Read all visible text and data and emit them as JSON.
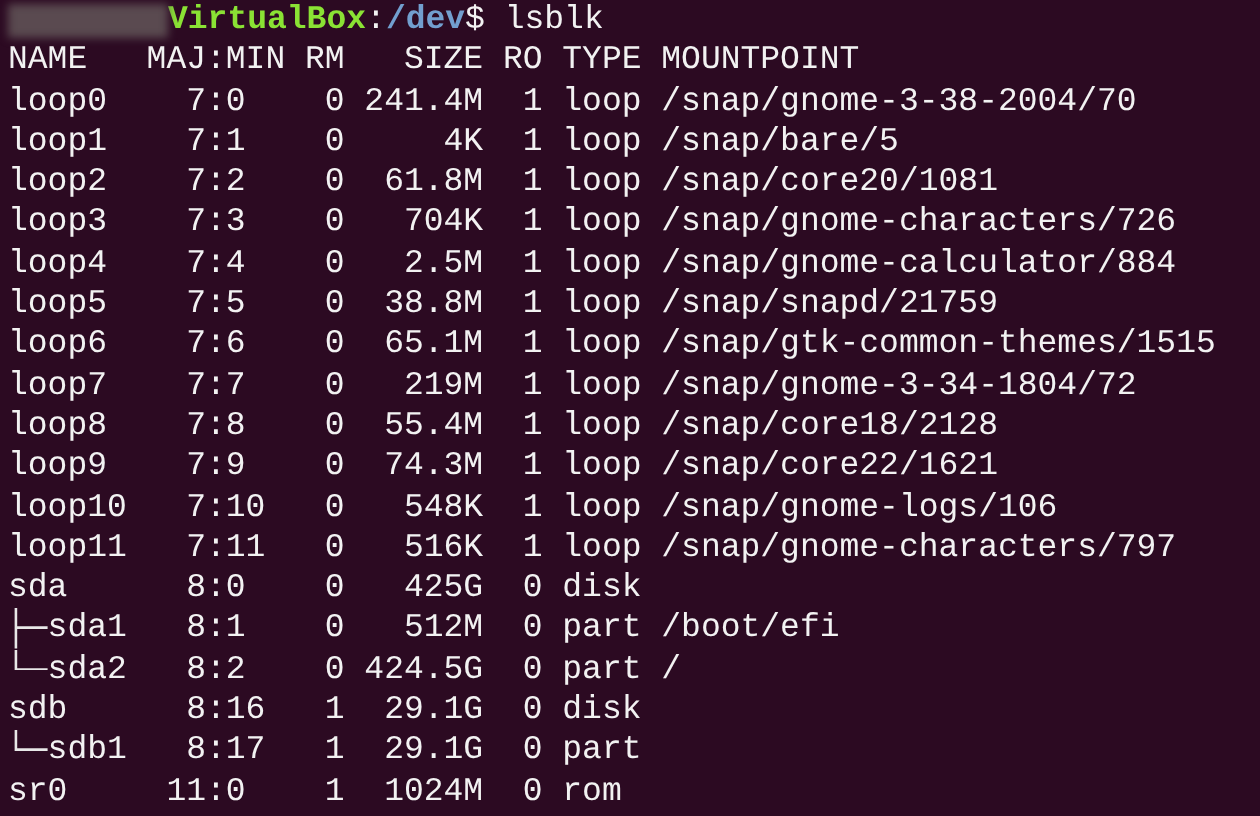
{
  "prompt": {
    "host": "VirtualBox",
    "separator": ":",
    "path": "/dev",
    "symbol": "$",
    "command": "lsblk"
  },
  "table": {
    "columns": [
      "NAME",
      "MAJ:MIN",
      "RM",
      "SIZE",
      "RO",
      "TYPE",
      "MOUNTPOINT"
    ],
    "rows": [
      {
        "name": "loop0",
        "majmin": "7:0",
        "rm": "0",
        "size": "241.4M",
        "ro": "1",
        "type": "loop",
        "mountpoint": "/snap/gnome-3-38-2004/70"
      },
      {
        "name": "loop1",
        "majmin": "7:1",
        "rm": "0",
        "size": "4K",
        "ro": "1",
        "type": "loop",
        "mountpoint": "/snap/bare/5"
      },
      {
        "name": "loop2",
        "majmin": "7:2",
        "rm": "0",
        "size": "61.8M",
        "ro": "1",
        "type": "loop",
        "mountpoint": "/snap/core20/1081"
      },
      {
        "name": "loop3",
        "majmin": "7:3",
        "rm": "0",
        "size": "704K",
        "ro": "1",
        "type": "loop",
        "mountpoint": "/snap/gnome-characters/726"
      },
      {
        "name": "loop4",
        "majmin": "7:4",
        "rm": "0",
        "size": "2.5M",
        "ro": "1",
        "type": "loop",
        "mountpoint": "/snap/gnome-calculator/884"
      },
      {
        "name": "loop5",
        "majmin": "7:5",
        "rm": "0",
        "size": "38.8M",
        "ro": "1",
        "type": "loop",
        "mountpoint": "/snap/snapd/21759"
      },
      {
        "name": "loop6",
        "majmin": "7:6",
        "rm": "0",
        "size": "65.1M",
        "ro": "1",
        "type": "loop",
        "mountpoint": "/snap/gtk-common-themes/1515"
      },
      {
        "name": "loop7",
        "majmin": "7:7",
        "rm": "0",
        "size": "219M",
        "ro": "1",
        "type": "loop",
        "mountpoint": "/snap/gnome-3-34-1804/72"
      },
      {
        "name": "loop8",
        "majmin": "7:8",
        "rm": "0",
        "size": "55.4M",
        "ro": "1",
        "type": "loop",
        "mountpoint": "/snap/core18/2128"
      },
      {
        "name": "loop9",
        "majmin": "7:9",
        "rm": "0",
        "size": "74.3M",
        "ro": "1",
        "type": "loop",
        "mountpoint": "/snap/core22/1621"
      },
      {
        "name": "loop10",
        "majmin": "7:10",
        "rm": "0",
        "size": "548K",
        "ro": "1",
        "type": "loop",
        "mountpoint": "/snap/gnome-logs/106"
      },
      {
        "name": "loop11",
        "majmin": "7:11",
        "rm": "0",
        "size": "516K",
        "ro": "1",
        "type": "loop",
        "mountpoint": "/snap/gnome-characters/797"
      },
      {
        "name": "sda",
        "majmin": "8:0",
        "rm": "0",
        "size": "425G",
        "ro": "0",
        "type": "disk",
        "children": [
          {
            "name": "sda1",
            "majmin": "8:1",
            "rm": "0",
            "size": "512M",
            "ro": "0",
            "type": "part",
            "mountpoint": "/boot/efi"
          },
          {
            "name": "sda2",
            "majmin": "8:2",
            "rm": "0",
            "size": "424.5G",
            "ro": "0",
            "type": "part",
            "mountpoint": "/"
          }
        ]
      },
      {
        "name": "sdb",
        "majmin": "8:16",
        "rm": "1",
        "size": "29.1G",
        "ro": "0",
        "type": "disk",
        "children": [
          {
            "name": "sdb1",
            "majmin": "8:17",
            "rm": "1",
            "size": "29.1G",
            "ro": "0",
            "type": "part"
          }
        ]
      },
      {
        "name": "sr0",
        "majmin": "11:0",
        "rm": "1",
        "size": "1024M",
        "ro": "0",
        "type": "rom"
      }
    ]
  }
}
